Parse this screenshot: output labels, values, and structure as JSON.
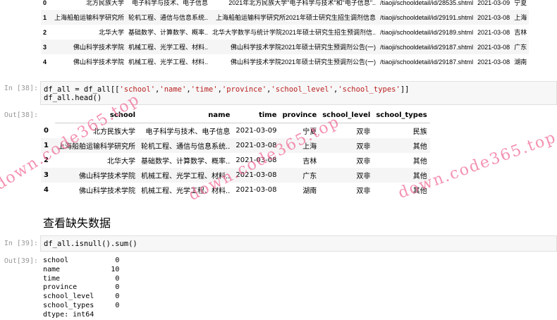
{
  "table_top": {
    "rows": [
      {
        "idx": "0",
        "school": "北方民族大学",
        "name": "电子科学与技术、电子信息",
        "title": "2021年北方民族大学\"电子科学与技术\"和\"电子信息\"..",
        "url": "/tiaoji/schooldetail/id/28535.shtml",
        "time": "2021-03-09",
        "province": "宁夏"
      },
      {
        "idx": "1",
        "school": "上海船舶运输科学研究所",
        "name": "轮机工程、通信与信息系统..",
        "title": "上海船舶运输科学研究所2021年硕士研究生招生调剂信息",
        "url": "/tiaoji/schooldetail/id/29191.shtml",
        "time": "2021-03-08",
        "province": "上海"
      },
      {
        "idx": "2",
        "school": "北华大学",
        "name": "基础数学、计算数学、概率..",
        "title": "北华大学数学与统计学院2021年硕士研究生招生预调剂信..",
        "url": "/tiaoji/schooldetail/id/29189.shtml",
        "time": "2021-03-08",
        "province": "吉林"
      },
      {
        "idx": "3",
        "school": "佛山科学技术学院",
        "name": "机械工程、光学工程、材料..",
        "title": "佛山科学技术学院2021年硕士研究生预调剂公告(一)",
        "url": "/tiaoji/schooldetail/id/29187.shtml",
        "time": "2021-03-08",
        "province": "广东"
      },
      {
        "idx": "4",
        "school": "佛山科学技术学院",
        "name": "机械工程、光学工程、材料..",
        "title": "佛山科学技术学院2021年硕士研究生预调剂公告(一)",
        "url": "/tiaoji/schooldetail/id/29187.shtml",
        "time": "2021-03-08",
        "province": "湖南"
      }
    ]
  },
  "cell38": {
    "in_prompt": "In [38]:",
    "out_prompt": "Out[38]:",
    "code": {
      "a": "df_all = df_all[[",
      "s1": "'school'",
      "s2": "'name'",
      "s3": "'time'",
      "s4": "'province'",
      "s5": "'school_level'",
      "s6": "'school_types'",
      "end": "]]",
      "line2": "df_all.head()",
      "comma": ","
    },
    "headers": [
      "school",
      "name",
      "time",
      "province",
      "school_level",
      "school_types"
    ],
    "rows": [
      {
        "idx": "0",
        "school": "北方民族大学",
        "name": "电子科学与技术、电子信息",
        "time": "2021-03-09",
        "province": "宁夏",
        "level": "双非",
        "types": "民族"
      },
      {
        "idx": "1",
        "school": "上海船舶运输科学研究所",
        "name": "轮机工程、通信与信息系统..",
        "time": "2021-03-08",
        "province": "上海",
        "level": "双非",
        "types": "其他"
      },
      {
        "idx": "2",
        "school": "北华大学",
        "name": "基础数学、计算数学、概率..",
        "time": "2021-03-08",
        "province": "吉林",
        "level": "双非",
        "types": "其他"
      },
      {
        "idx": "3",
        "school": "佛山科学技术学院",
        "name": "机械工程、光学工程、材料..",
        "time": "2021-03-08",
        "province": "广东",
        "level": "双非",
        "types": "其他"
      },
      {
        "idx": "4",
        "school": "佛山科学技术学院",
        "name": "机械工程、光学工程、材料..",
        "time": "2021-03-08",
        "province": "湖南",
        "level": "双非",
        "types": "其他"
      }
    ]
  },
  "heading": "查看缺失数据",
  "cell39": {
    "in_prompt": "In [39]:",
    "out_prompt": "Out[39]:",
    "code": "df_all.isnull().sum()",
    "output": "school           0\nname            10\ntime             0\nprovince         0\nschool_level     0\nschool_types     0\ndtype: int64"
  },
  "watermark": "down.code365.top"
}
